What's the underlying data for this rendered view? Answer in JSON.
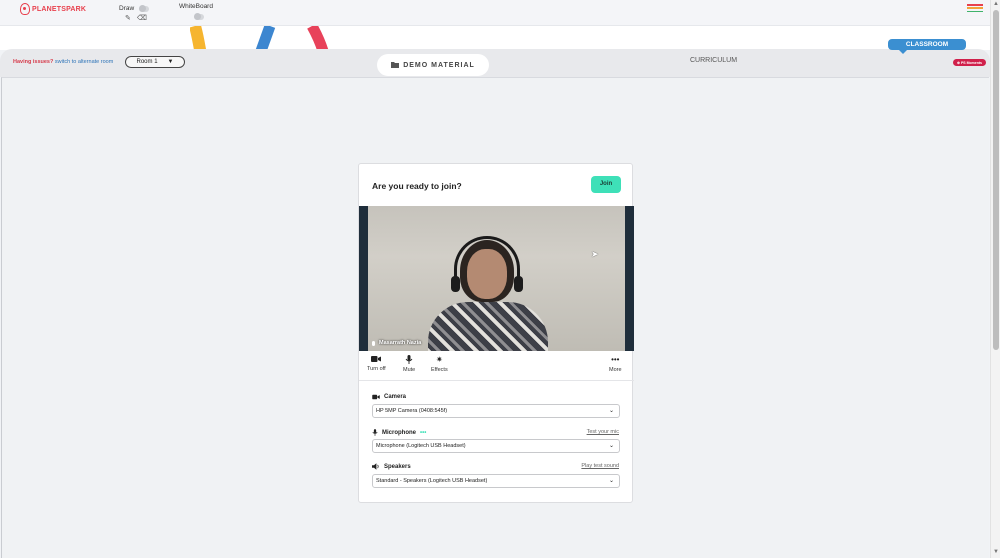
{
  "header": {
    "logo_text": "PLANETSPARK",
    "draw_label": "Draw",
    "whiteboard_label": "WhiteBoard",
    "pencil_icon": "pencil-icon",
    "eraser_icon": "eraser-icon",
    "menu_icon": "hamburger-menu-icon",
    "menu_colors": [
      "#e8404d",
      "#f2a33a",
      "#3fb36b"
    ]
  },
  "roombar": {
    "issues_text": "Having issues?",
    "switch_link": "switch to alternate room",
    "room_value": "Room 1",
    "room_chevron": "▼",
    "demo_tab": "DEMO MATERIAL",
    "curriculum_tab": "CURRICULUM",
    "classroom_tab": "CLASSROOM",
    "moments_badge": "PS Moments"
  },
  "join_card": {
    "title": "Are you ready to join?",
    "join_label": "Join",
    "participant_name": "Masarrath Nazia",
    "controls": {
      "turn_off": "Turn off",
      "mute": "Mute",
      "effects": "Effects",
      "more": "More"
    },
    "camera": {
      "label": "Camera",
      "value": "HP 5MP Camera (0408:545f)"
    },
    "microphone": {
      "label": "Microphone",
      "indicator": "•••",
      "link": "Test your mic",
      "value": "Microphone (Logitech USB Headset)"
    },
    "speakers": {
      "label": "Speakers",
      "link": "Play test sound",
      "value": "Standard - Speakers (Logitech USB Headset)"
    }
  },
  "colors": {
    "accent_join": "#3ee0b8",
    "classroom_blue": "#3b8fd1",
    "brand_red": "#e8404d",
    "badge_red": "#d0204b"
  }
}
